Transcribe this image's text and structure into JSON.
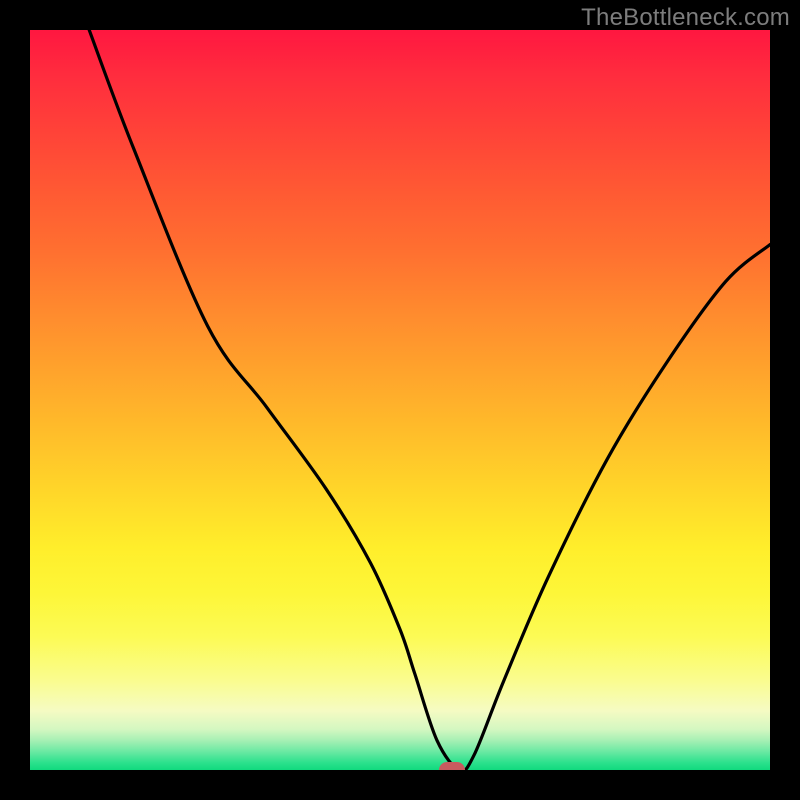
{
  "watermark": "TheBottleneck.com",
  "colors": {
    "page_bg": "#000000",
    "curve_stroke": "#000000",
    "marker_fill": "#c85b5f",
    "watermark_text": "#7d7d7d"
  },
  "chart_data": {
    "type": "line",
    "title": "",
    "xlabel": "",
    "ylabel": "",
    "xlim": [
      0,
      100
    ],
    "ylim": [
      0,
      100
    ],
    "grid": false,
    "series": [
      {
        "name": "bottleneck-curve",
        "x": [
          8,
          14,
          24,
          32,
          40,
          46,
          50,
          52,
          55,
          58,
          60,
          64,
          70,
          78,
          86,
          94,
          100
        ],
        "values": [
          100,
          84,
          60,
          49,
          38,
          28,
          19,
          13,
          4,
          0,
          2,
          12,
          26,
          42,
          55,
          66,
          71
        ]
      }
    ],
    "marker": {
      "x": 57,
      "y": 0
    },
    "background_gradient_stops": [
      {
        "pos": 0,
        "color": "#ff1740"
      },
      {
        "pos": 50,
        "color": "#ffbc2a"
      },
      {
        "pos": 90,
        "color": "#fafc90"
      },
      {
        "pos": 100,
        "color": "#10da7e"
      }
    ]
  }
}
